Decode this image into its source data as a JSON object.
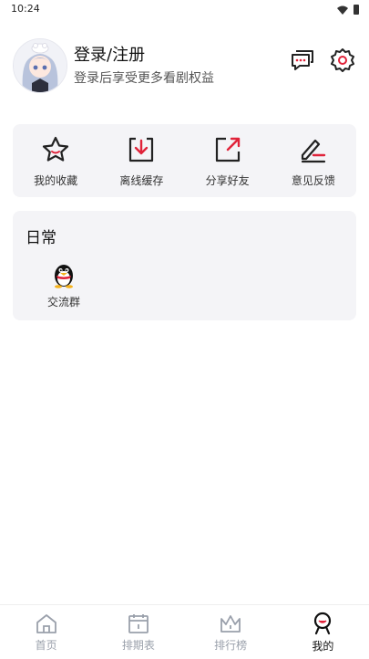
{
  "status": {
    "time": "10:24"
  },
  "profile": {
    "name": "登录/注册",
    "subtitle": "登录后享受更多看剧权益"
  },
  "quick_actions": [
    {
      "label": "我的收藏",
      "icon": "star-icon"
    },
    {
      "label": "离线缓存",
      "icon": "download-icon"
    },
    {
      "label": "分享好友",
      "icon": "share-icon"
    },
    {
      "label": "意见反馈",
      "icon": "feedback-icon"
    }
  ],
  "daily": {
    "title": "日常",
    "items": [
      {
        "label": "交流群",
        "icon": "qq-penguin-icon"
      }
    ]
  },
  "nav": [
    {
      "label": "首页",
      "icon": "home-icon"
    },
    {
      "label": "排期表",
      "icon": "calendar-icon"
    },
    {
      "label": "排行榜",
      "icon": "crown-icon"
    },
    {
      "label": "我的",
      "icon": "profile-icon"
    }
  ],
  "colors": {
    "accent": "#e0233a",
    "card_bg": "#f4f4f7",
    "inactive": "#9aa0ab"
  }
}
